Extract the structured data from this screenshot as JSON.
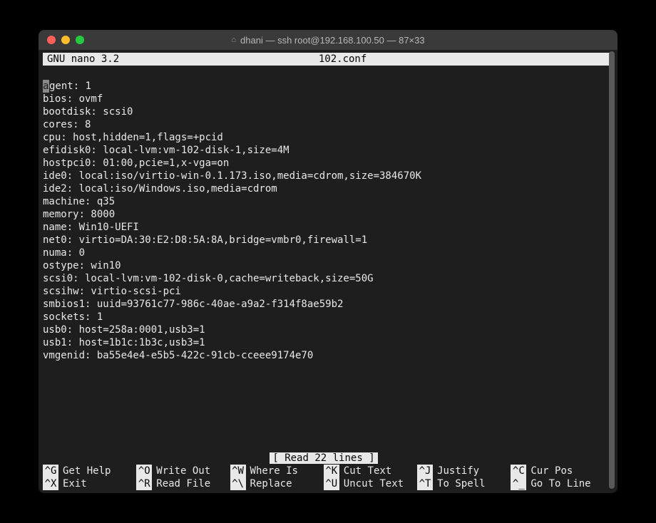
{
  "window": {
    "title": "dhani — ssh root@192.168.100.50 — 87×33"
  },
  "nano": {
    "app_name": "  GNU nano 3.2",
    "filename": "102.conf",
    "status": "[ Read 22 lines ]",
    "content": "agent: 1\nbios: ovmf\nbootdisk: scsi0\ncores: 8\ncpu: host,hidden=1,flags=+pcid\nefidisk0: local-lvm:vm-102-disk-1,size=4M\nhostpci0: 01:00,pcie=1,x-vga=on\nide0: local:iso/virtio-win-0.1.173.iso,media=cdrom,size=384670K\nide2: local:iso/Windows.iso,media=cdrom\nmachine: q35\nmemory: 8000\nname: Win10-UEFI\nnet0: virtio=DA:30:E2:D8:5A:8A,bridge=vmbr0,firewall=1\nnuma: 0\nostype: win10\nscsi0: local-lvm:vm-102-disk-0,cache=writeback,size=50G\nscsihw: virtio-scsi-pci\nsmbios1: uuid=93761c77-986c-40ae-a9a2-f314f8ae59b2\nsockets: 1\nusb0: host=258a:0001,usb3=1\nusb1: host=1b1c:1b3c,usb3=1\nvmgenid: ba55e4e4-e5b5-422c-91cb-cceee9174e70",
    "cursor_char": "a"
  },
  "shortcuts": {
    "row1": [
      {
        "key": "^G",
        "label": "Get Help"
      },
      {
        "key": "^O",
        "label": "Write Out"
      },
      {
        "key": "^W",
        "label": "Where Is"
      },
      {
        "key": "^K",
        "label": "Cut Text"
      },
      {
        "key": "^J",
        "label": "Justify"
      },
      {
        "key": "^C",
        "label": "Cur Pos"
      }
    ],
    "row2": [
      {
        "key": "^X",
        "label": "Exit"
      },
      {
        "key": "^R",
        "label": "Read File"
      },
      {
        "key": "^\\",
        "label": "Replace"
      },
      {
        "key": "^U",
        "label": "Uncut Text"
      },
      {
        "key": "^T",
        "label": "To Spell"
      },
      {
        "key": "^_",
        "label": "Go To Line"
      }
    ]
  }
}
